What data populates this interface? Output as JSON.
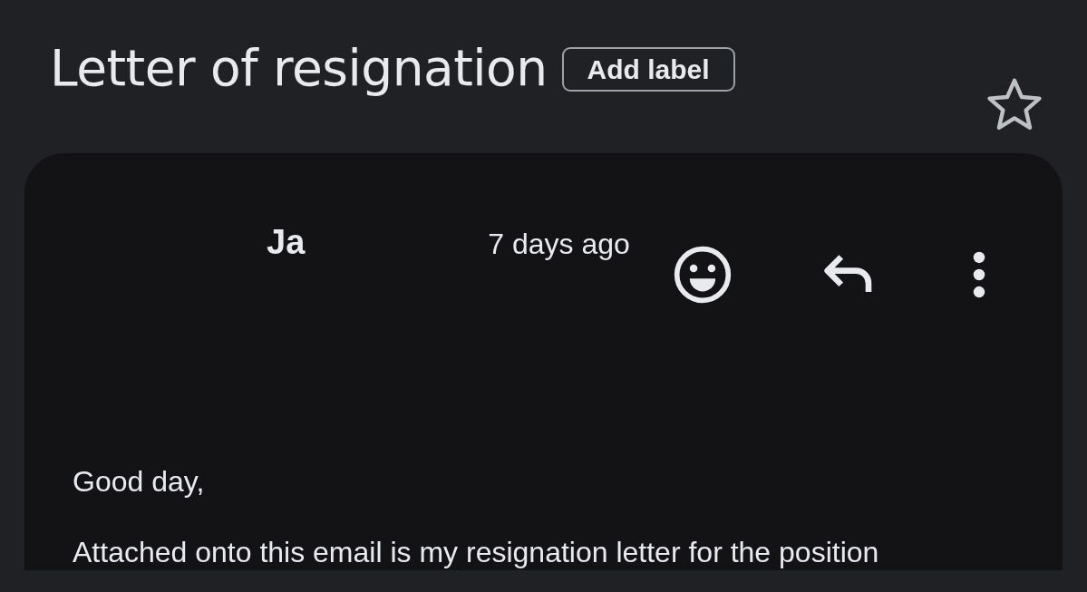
{
  "subject": "Letter of resignation",
  "add_label_button": "Add label",
  "starred": false,
  "message": {
    "sender": "Ja",
    "time": "7 days ago",
    "body": [
      "Good day,",
      "Attached onto this email is my resignation letter for the position"
    ]
  }
}
